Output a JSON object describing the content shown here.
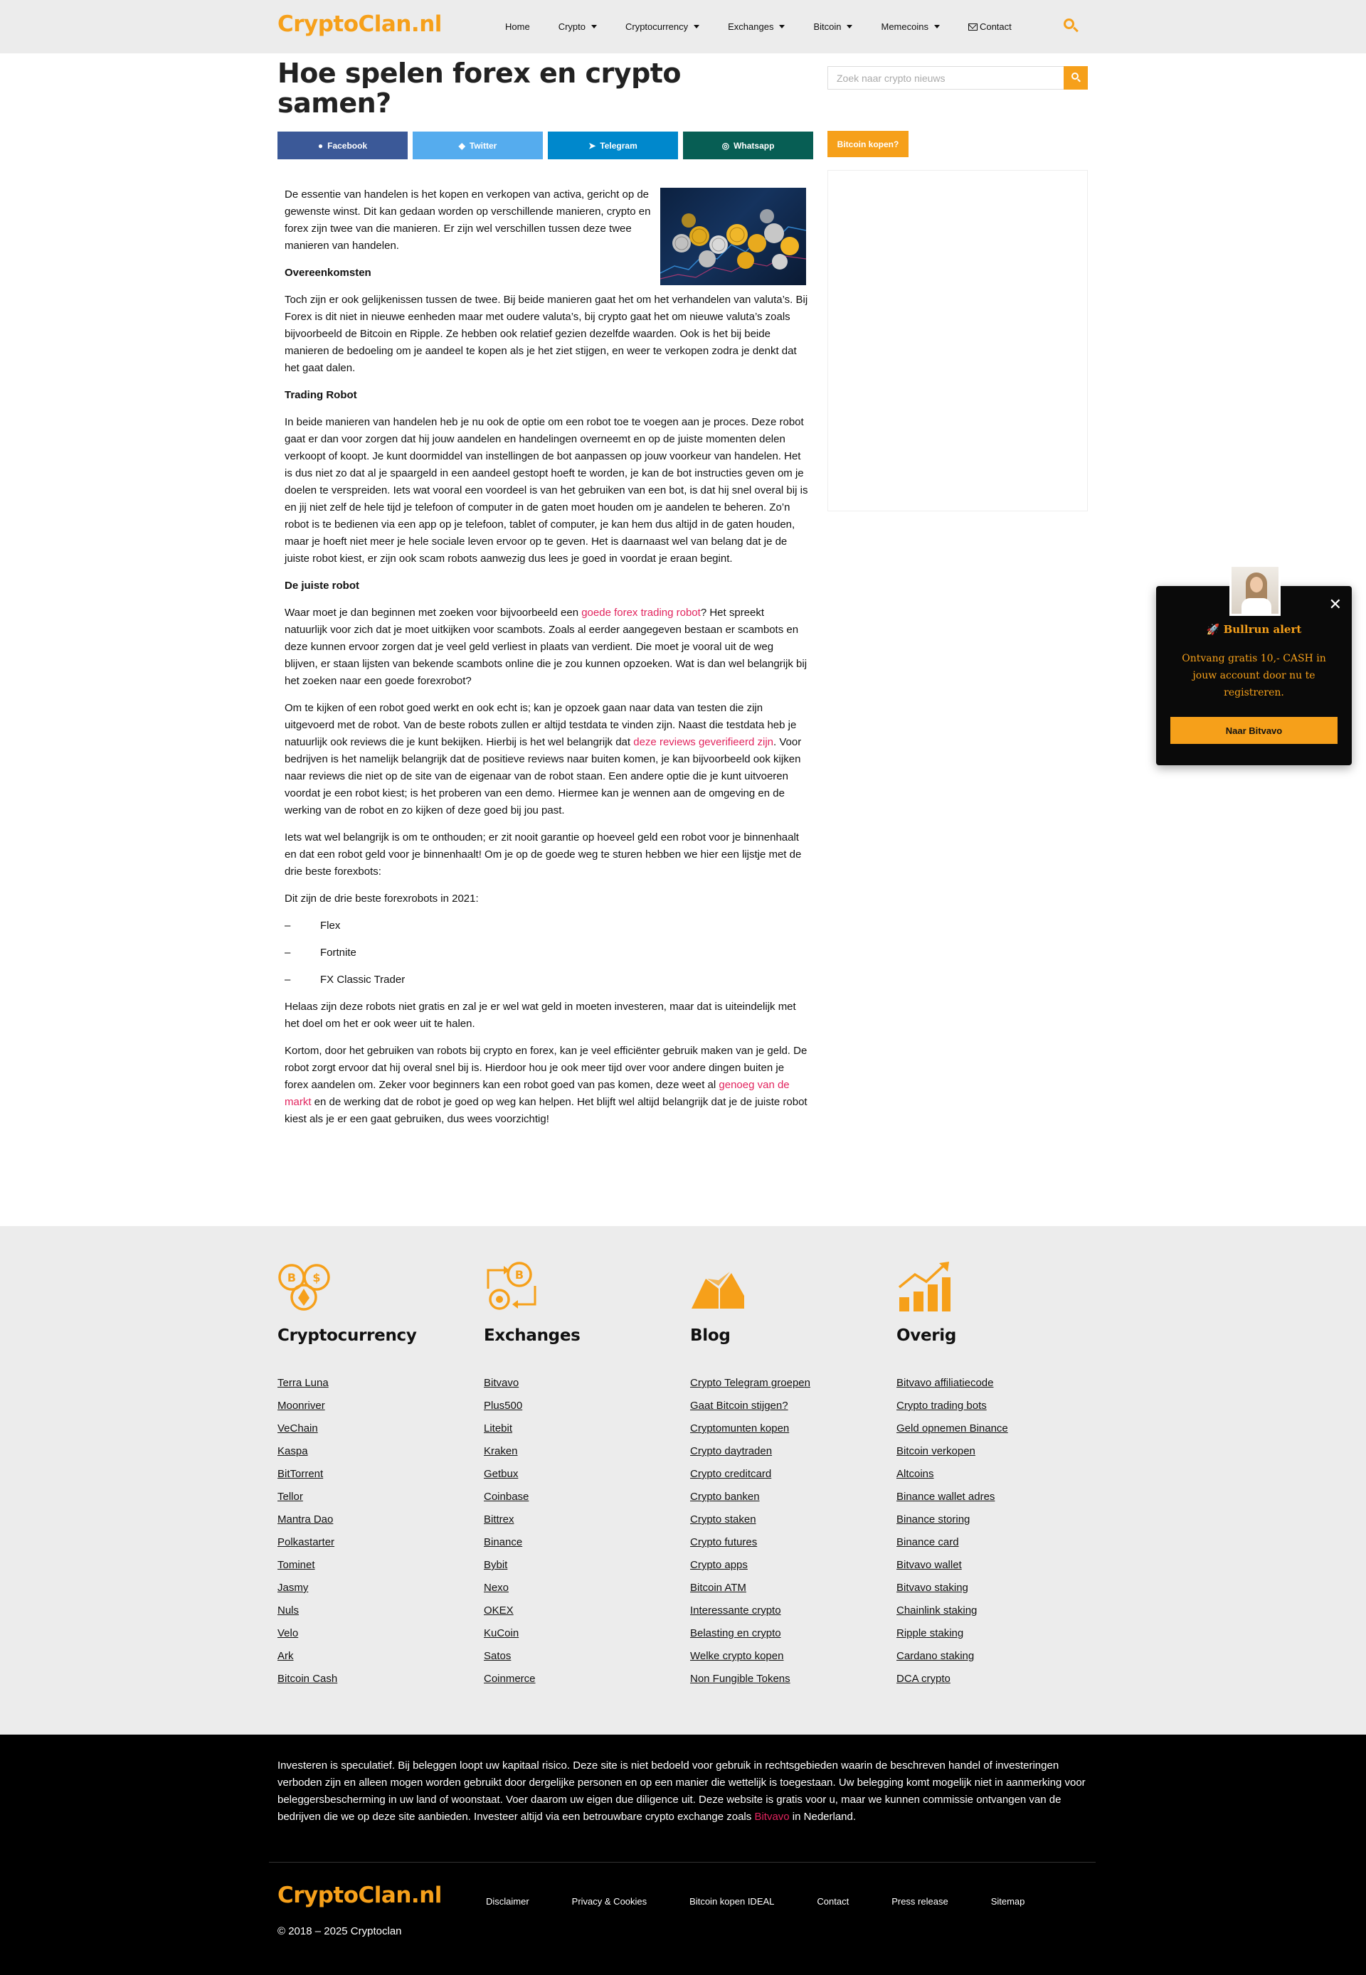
{
  "brand": {
    "logo_text": "CryptoClan.nl",
    "accent_color": "#f6a01a",
    "link_color": "#e2245e"
  },
  "nav": {
    "items": [
      {
        "label": "Home",
        "dropdown": false
      },
      {
        "label": "Crypto",
        "dropdown": true
      },
      {
        "label": "Cryptocurrency",
        "dropdown": true
      },
      {
        "label": "Exchanges",
        "dropdown": true
      },
      {
        "label": "Bitcoin",
        "dropdown": true
      },
      {
        "label": "Memecoins",
        "dropdown": true
      }
    ],
    "contact_label": "Contact"
  },
  "article": {
    "title": "Hoe spelen forex en crypto samen?",
    "share": {
      "facebook": "Facebook",
      "twitter": "Twitter",
      "telegram": "Telegram",
      "whatsapp": "Whatsapp"
    },
    "p1": "De essentie van handelen is het kopen en verkopen van activa, gericht op de gewenste winst. Dit kan gedaan worden op verschillende manieren, crypto en forex zijn twee van die manieren. Er zijn wel verschillen tussen deze twee manieren van handelen.",
    "h1": "Overeenkomsten",
    "p2": "Toch zijn er ook gelijkenissen tussen de twee. Bij beide manieren gaat het om het verhandelen van valuta’s. Bij Forex is dit niet in nieuwe eenheden maar met oudere valuta’s, bij crypto gaat het om nieuwe valuta’s zoals bijvoorbeeld de Bitcoin en Ripple. Ze hebben ook relatief gezien dezelfde waarden. Ook is het bij beide manieren de bedoeling om je aandeel te kopen als je het ziet stijgen, en weer te verkopen zodra je denkt dat het gaat dalen.",
    "h2": "Trading Robot",
    "p3": "In beide manieren van handelen heb je nu ook de optie om een robot toe te voegen aan je proces. Deze robot gaat er dan voor zorgen dat hij jouw aandelen en handelingen overneemt en op de juiste momenten delen verkoopt of koopt. Je kunt doormiddel van instellingen de bot aanpassen op jouw voorkeur van handelen. Het is dus niet zo dat al je spaargeld in een aandeel gestopt hoeft te worden, je kan de bot instructies geven om je doelen te verspreiden. Iets wat vooral een voordeel is van het gebruiken van een bot, is dat hij snel overal bij is en jij niet zelf de hele tijd je telefoon of computer in de gaten moet houden om je aandelen te beheren. Zo’n robot is te bedienen via een app op je telefoon, tablet of computer, je kan hem dus altijd in de gaten houden, maar je hoeft niet meer je hele sociale leven ervoor op te geven. Het is daarnaast wel van belang dat je de juiste robot kiest, er zijn ook scam robots aanwezig dus lees je goed in voordat je eraan begint.",
    "h3": "De juiste robot",
    "p4_a": "Waar moet je dan beginnen met zoeken voor bijvoorbeeld een ",
    "p4_link": "goede forex trading robot",
    "p4_b": "? Het spreekt natuurlijk voor zich dat je moet uitkijken voor scambots. Zoals al eerder aangegeven bestaan er scambots en deze kunnen ervoor zorgen dat je veel geld verliest in plaats van verdient. Die moet je vooral uit de weg blijven, er staan lijsten van bekende scambots online die je zou kunnen opzoeken. Wat is dan wel belangrijk bij het zoeken naar een goede forexrobot?",
    "p5_a": "Om te kijken of een robot goed werkt en ook echt is; kan je opzoek gaan naar data van testen die zijn uitgevoerd met de robot. Van de beste robots zullen er altijd testdata te vinden zijn. Naast die testdata heb je natuurlijk ook reviews die je kunt bekijken. Hierbij is het wel belangrijk dat ",
    "p5_link": "deze reviews geverifieerd zijn",
    "p5_b": ". Voor bedrijven is het namelijk belangrijk dat de positieve reviews naar buiten komen, je kan bijvoorbeeld ook kijken naar reviews die niet op de site van de eigenaar van de robot staan. Een andere optie die je kunt uitvoeren voordat je een robot kiest; is het proberen van een demo. Hiermee kan je wennen aan de omgeving en de werking van de robot en zo kijken of deze goed bij jou past.",
    "p6": "Iets wat wel belangrijk is om te onthouden; er zit nooit garantie op hoeveel geld een robot voor je binnenhaalt en dat een robot geld voor je binnenhaalt! Om je op de goede weg te sturen hebben we hier een lijstje met de drie beste forexbots:",
    "p7": "Dit zijn de drie beste forexrobots in 2021:",
    "list_dash": "–",
    "list": [
      "Flex",
      "Fortnite",
      "FX Classic Trader"
    ],
    "p8": "Helaas zijn deze robots niet gratis en zal je er wel wat geld in moeten investeren, maar dat is uiteindelijk met het doel om het er ook weer uit te halen.",
    "p9_a": "Kortom, door het gebruiken van robots bij crypto en forex, kan je veel efficiënter gebruik maken van je geld. De robot zorgt ervoor dat hij overal snel bij is. Hierdoor hou je ook meer tijd over voor andere dingen buiten je forex aandelen om. Zeker voor beginners kan een robot goed van pas komen, deze weet al ",
    "p9_link": "genoeg van de markt",
    "p9_b": " en de werking dat de robot je goed op weg kan helpen. Het blijft wel altijd belangrijk dat je de juiste robot kiest als je er een gaat gebruiken, dus wees voorzichtig!"
  },
  "sidebar": {
    "search_placeholder": "Zoek naar crypto nieuws",
    "buy_button": "Bitcoin kopen?"
  },
  "popup": {
    "title": "🚀 Bullrun alert",
    "text": "Ontvang gratis 10,- CASH in jouw account door nu te registreren.",
    "button": "Naar Bitvavo",
    "close": "✕"
  },
  "footer": {
    "columns": [
      {
        "title": "Cryptocurrency",
        "icon": "crypto-coins-icon",
        "links": [
          "Terra Luna",
          "Moonriver",
          "VeChain",
          "Kaspa",
          "BitTorrent",
          "Tellor",
          "Mantra Dao",
          "Polkastarter",
          "Tominet",
          "Jasmy",
          "Nuls",
          "Velo",
          "Ark",
          "Bitcoin Cash"
        ]
      },
      {
        "title": "Exchanges",
        "icon": "exchange-icon",
        "links": [
          "Bitvavo",
          "Plus500",
          "Litebit",
          "Kraken",
          "Getbux",
          "Coinbase",
          "Bittrex",
          "Binance",
          "Bybit",
          "Nexo",
          "OKEX",
          "KuCoin",
          "Satos",
          "Coinmerce"
        ]
      },
      {
        "title": "Blog",
        "icon": "book-icon",
        "links": [
          "Crypto Telegram groepen",
          "Gaat Bitcoin stijgen?",
          "Cryptomunten kopen",
          "Crypto daytraden",
          "Crypto creditcard",
          "Crypto banken",
          "Crypto staken",
          "Crypto futures",
          "Crypto apps",
          "Bitcoin ATM",
          "Interessante crypto",
          "Belasting en crypto",
          "Welke crypto kopen",
          "Non Fungible Tokens"
        ]
      },
      {
        "title": "Overig",
        "icon": "growth-chart-icon",
        "links": [
          "Bitvavo affiliatiecode",
          "Crypto trading bots",
          "Geld opnemen Binance",
          "Bitcoin verkopen",
          "Altcoins",
          "Binance wallet adres",
          "Binance storing",
          "Binance card",
          "Bitvavo wallet",
          "Bitvavo staking",
          "Chainlink staking",
          "Ripple staking",
          "Cardano staking",
          "DCA crypto"
        ]
      }
    ],
    "disclaimer_a": "Investeren is speculatief. Bij beleggen loopt uw kapitaal risico. Deze site is niet bedoeld voor gebruik in rechtsgebieden waarin de beschreven handel of investeringen verboden zijn en alleen mogen worden gebruikt door dergelijke personen en op een manier die wettelijk is toegestaan. Uw belegging komt mogelijk niet in aanmerking voor beleggersbescherming in uw land of woonstaat. Voer daarom uw eigen due diligence uit. Deze website is gratis voor u, maar we kunnen commissie ontvangen van de bedrijven die we op deze site aanbieden. Investeer altijd via een betrouwbare crypto exchange zoals ",
    "disclaimer_link": "Bitvavo",
    "disclaimer_b": " in Nederland.",
    "bottom_nav": [
      "Disclaimer",
      "Privacy & Cookies",
      "Bitcoin kopen IDEAL",
      "Contact",
      "Press release",
      "Sitemap"
    ],
    "copyright": "© 2018 – 2025 Cryptoclan"
  }
}
